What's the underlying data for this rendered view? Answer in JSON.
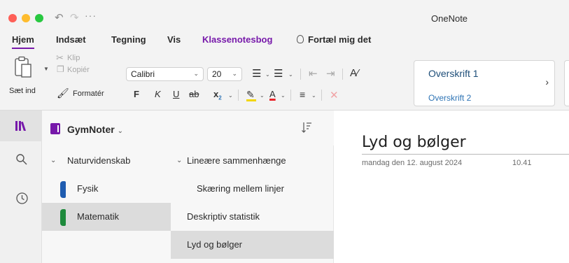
{
  "app": {
    "title": "OneNote"
  },
  "quick_access": {
    "more_label": "···"
  },
  "ribbon_tabs": [
    {
      "label": "Hjem"
    },
    {
      "label": "Indsæt"
    },
    {
      "label": "Tegning"
    },
    {
      "label": "Vis"
    },
    {
      "label": "Klassenotesbog"
    },
    {
      "label": "Fortæl mig det"
    }
  ],
  "clipboard": {
    "paste_label": "Sæt ind",
    "cut_label": "Klip",
    "copy_label": "Kopiér",
    "format_painter_label": "Formatér"
  },
  "font": {
    "name": "Calibri",
    "size": "20",
    "bold": "F",
    "italic": "K",
    "underline": "U",
    "strikethrough": "ab",
    "subscript": "x"
  },
  "styles": {
    "heading1": "Overskrift 1",
    "heading2": "Overskrift 2"
  },
  "notebook": {
    "name": "GymNoter"
  },
  "sections": [
    {
      "label": "Naturvidenskab",
      "type": "group",
      "expanded": true
    },
    {
      "label": "Fysik",
      "color": "#1f5cb0"
    },
    {
      "label": "Matematik",
      "color": "#1e8a3c",
      "selected": true
    }
  ],
  "pages": [
    {
      "label": "Lineære sammenhænge",
      "expanded": true
    },
    {
      "label": "Skæring mellem linjer",
      "subpage": true
    },
    {
      "label": "Deskriptiv statistik"
    },
    {
      "label": "Lyd og bølger",
      "selected": true
    }
  ],
  "canvas": {
    "title": "Lyd og bølger",
    "date": "mandag den 12. august 2024",
    "time": "10.41"
  },
  "colors": {
    "accent": "#7719aa",
    "highlight": "#f2d600",
    "font_color": "#e8252a",
    "heading1": "#1e4e79",
    "heading2": "#2e74b5"
  }
}
